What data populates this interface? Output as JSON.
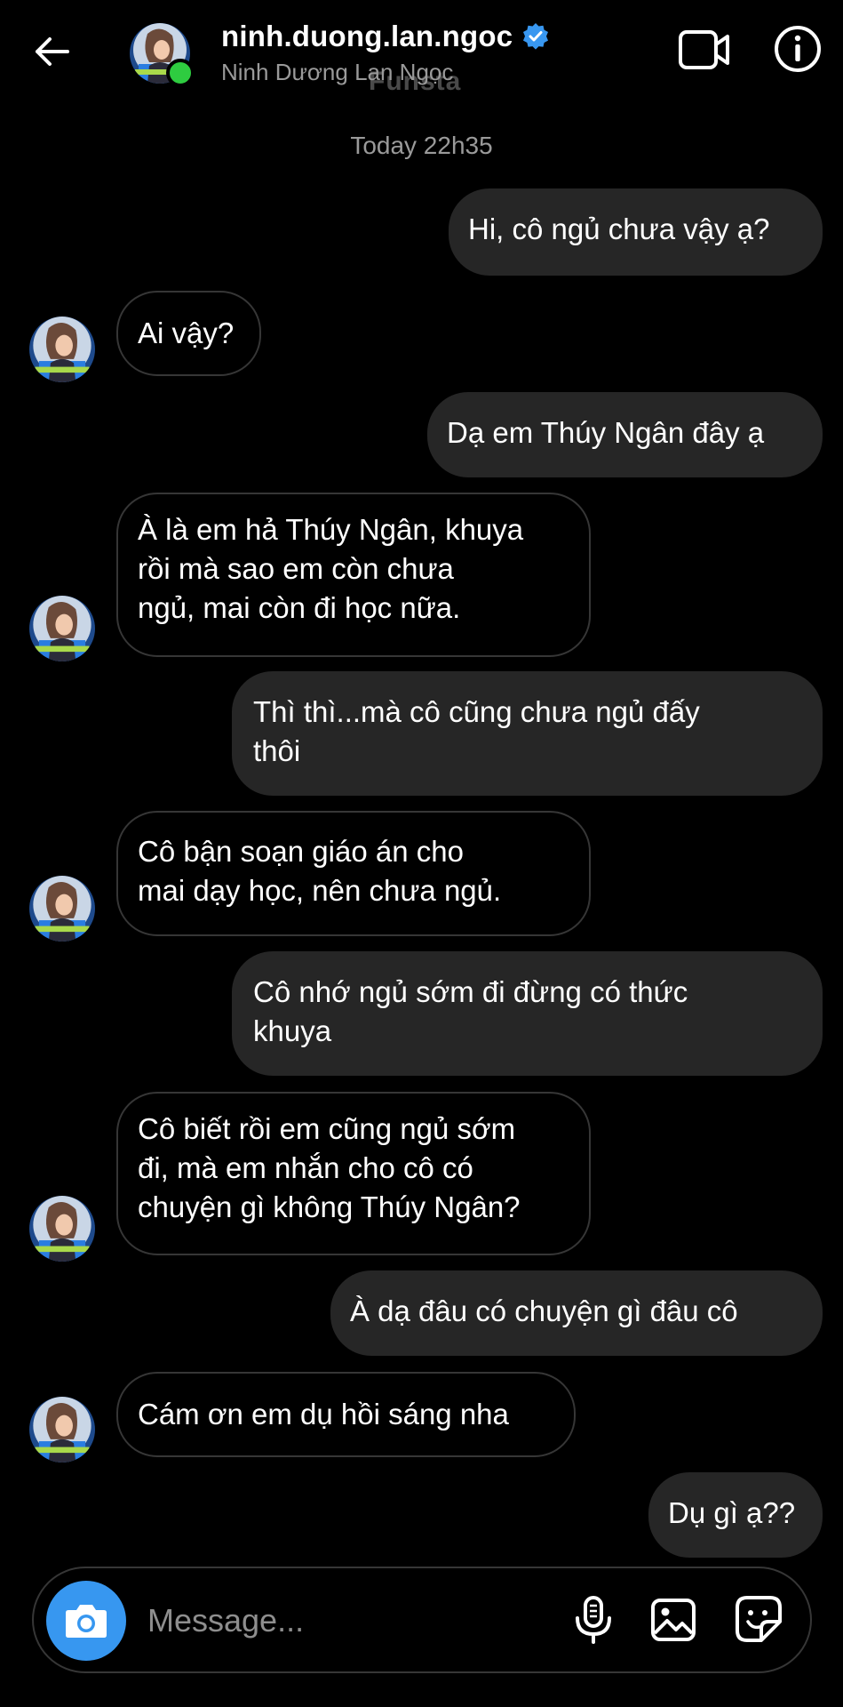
{
  "header": {
    "username": "ninh.duong.lan.ngoc",
    "full_name": "Ninh Dương Lan Ngọc",
    "watermark": "Funsta"
  },
  "timestamp": "Today 22h35",
  "messages": [
    {
      "from": "me",
      "text": "Hi, cô ngủ chưa vậy ạ?"
    },
    {
      "from": "them",
      "text": "Ai vậy?"
    },
    {
      "from": "me",
      "text": "Dạ em Thúy Ngân đây ạ"
    },
    {
      "from": "them",
      "lines": [
        "À là em hả Thúy Ngân, khuya",
        "rồi mà sao em còn chưa",
        "ngủ, mai còn đi học nữa."
      ]
    },
    {
      "from": "me",
      "lines": [
        "Thì thì...mà cô cũng chưa ngủ đấy",
        "thôi"
      ]
    },
    {
      "from": "them",
      "lines": [
        "Cô bận soạn giáo án cho",
        "mai dạy học, nên chưa ngủ."
      ]
    },
    {
      "from": "me",
      "lines": [
        "Cô nhớ ngủ sớm đi đừng có thức",
        "khuya"
      ]
    },
    {
      "from": "them",
      "lines": [
        "Cô biết rồi em cũng ngủ sớm",
        "đi, mà em nhắn cho cô có",
        "chuyện gì không Thúy Ngân?"
      ]
    },
    {
      "from": "me",
      "text": "À dạ đâu có chuyện gì đâu cô"
    },
    {
      "from": "them",
      "text": "Cám ơn em dụ hồi sáng nha"
    },
    {
      "from": "me",
      "text": "Dụ gì ạ??"
    }
  ],
  "composer": {
    "placeholder": "Message..."
  },
  "colors": {
    "background": "#000000",
    "sent_bubble": "#262626",
    "received_border": "#363636",
    "accent_blue": "#3797f0",
    "online_green": "#2ecc40",
    "verified_blue": "#3897f0"
  },
  "icons": {
    "back": "arrow-left-icon",
    "video": "video-camera-icon",
    "info": "info-icon",
    "verified": "verified-badge-icon",
    "camera": "camera-icon",
    "mic": "microphone-icon",
    "gallery": "image-icon",
    "sticker": "sticker-icon"
  }
}
